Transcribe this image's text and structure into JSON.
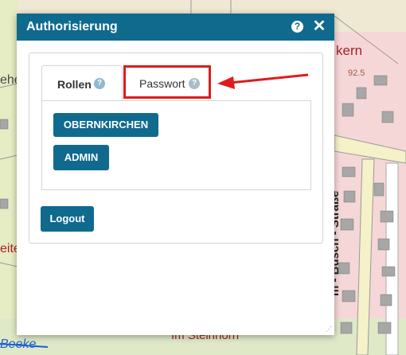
{
  "dialog": {
    "title": "Authorisierung",
    "help_icon": "question-circle-icon",
    "close_icon": "close-x-icon",
    "close_glyph": "✕",
    "help_glyph": "?"
  },
  "tabs": [
    {
      "label": "Rollen",
      "active": true,
      "icon": "help-icon"
    },
    {
      "label": "Passwort",
      "active": false,
      "icon": "help-icon"
    }
  ],
  "roles": [
    "OBERNKIRCHEN",
    "ADMIN"
  ],
  "logout_label": "Logout",
  "map": {
    "labels": {
      "kern": "kern",
      "elevation": "92.5",
      "eite": "eite",
      "ehe": "ehe",
      "street": "m - Busch - Straße",
      "beeke": "Beeke",
      "steinhorn": "Im Steinhorn"
    }
  },
  "colors": {
    "header": "#0f6a8e",
    "button": "#0f6a8e",
    "annotation": "#e01b1b"
  }
}
